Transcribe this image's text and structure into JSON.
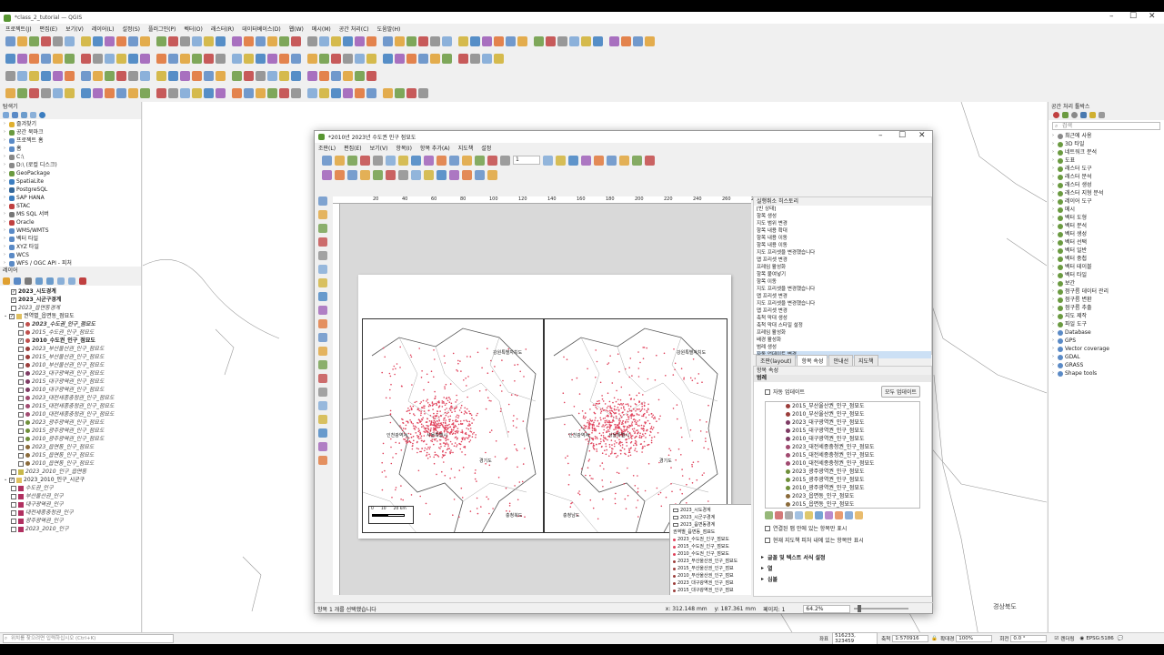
{
  "app": {
    "title": "*class_2_tutorial — QGIS",
    "menu": [
      "프로젝트(J)",
      "편집(E)",
      "보기(V)",
      "레이어(L)",
      "설정(S)",
      "플러그인(P)",
      "벡터(O)",
      "래스터(R)",
      "데이터베이스(D)",
      "웹(W)",
      "메시(M)",
      "공간 처리(C)",
      "도움말(H)"
    ]
  },
  "browser": {
    "title": "탐색기",
    "items": [
      "즐겨찾기",
      "공간 북마크",
      "프로젝트 홈",
      "홈",
      "C:\\",
      "D:\\ (로컬 디스크)",
      "GeoPackage",
      "SpatiaLite",
      "PostgreSQL",
      "SAP HANA",
      "STAC",
      "MS SQL 서버",
      "Oracle",
      "WMS/WMTS",
      "벡터 타일",
      "XYZ 타일",
      "WCS",
      "WFS / OGC API - 피처",
      "ArcGIS REST 서버",
      "신",
      "Cloud"
    ]
  },
  "layers": {
    "title": "레이어",
    "items": [
      {
        "label": "2023_시도경계",
        "style": "bold",
        "checked": true,
        "indent": 1
      },
      {
        "label": "2023_시군구경계",
        "style": "bold",
        "checked": true,
        "indent": 1
      },
      {
        "label": "2023_읍면동경계",
        "style": "italic",
        "checked": false,
        "indent": 1
      },
      {
        "label": "권역별_읍면동_점묘도",
        "style": "normal",
        "checked": true,
        "indent": 0,
        "group": true
      },
      {
        "label": "2023_수도권_인구_점묘도",
        "style": "bolditalic",
        "checked": false,
        "indent": 2,
        "dot": "#c0504d"
      },
      {
        "label": "2015_수도권_인구_점묘도",
        "style": "italic",
        "checked": false,
        "indent": 2,
        "dot": "#c0504d"
      },
      {
        "label": "2010_수도권_인구_점묘도",
        "style": "bold",
        "checked": true,
        "indent": 2,
        "dot": "#c0504d"
      },
      {
        "label": "2023_부산울산권_인구_점묘도",
        "style": "italic",
        "checked": false,
        "indent": 2,
        "dot": "#9b3d3a"
      },
      {
        "label": "2015_부산울산권_인구_점묘도",
        "style": "italic",
        "checked": false,
        "indent": 2,
        "dot": "#9b3d3a"
      },
      {
        "label": "2010_부산울산권_인구_점묘도",
        "style": "italic",
        "checked": false,
        "indent": 2,
        "dot": "#9b3d3a"
      },
      {
        "label": "2023_대구광역권_인구_점묘도",
        "style": "italic",
        "checked": false,
        "indent": 2,
        "dot": "#7e3b64"
      },
      {
        "label": "2015_대구광역권_인구_점묘도",
        "style": "italic",
        "checked": false,
        "indent": 2,
        "dot": "#7e3b64"
      },
      {
        "label": "2010_대구광역권_인구_점묘도",
        "style": "italic",
        "checked": false,
        "indent": 2,
        "dot": "#7e3b64"
      },
      {
        "label": "2023_대전세종충청권_인구_점묘도",
        "style": "italic",
        "checked": false,
        "indent": 2,
        "dot": "#a04a70"
      },
      {
        "label": "2015_대전세종충청권_인구_점묘도",
        "style": "italic",
        "checked": false,
        "indent": 2,
        "dot": "#a04a70"
      },
      {
        "label": "2010_대전세종충청권_인구_점묘도",
        "style": "italic",
        "checked": false,
        "indent": 2,
        "dot": "#a04a70"
      },
      {
        "label": "2023_광주광역권_인구_점묘도",
        "style": "italic",
        "checked": false,
        "indent": 2,
        "dot": "#6f8f3a"
      },
      {
        "label": "2015_광주광역권_인구_점묘도",
        "style": "italic",
        "checked": false,
        "indent": 2,
        "dot": "#6f8f3a"
      },
      {
        "label": "2010_광주광역권_인구_점묘도",
        "style": "italic",
        "checked": false,
        "indent": 2,
        "dot": "#6f8f3a"
      },
      {
        "label": "2023_읍면동_인구_점묘도",
        "style": "italic",
        "checked": false,
        "indent": 2,
        "dot": "#8a6a3a"
      },
      {
        "label": "2015_읍면동_인구_점묘도",
        "style": "italic",
        "checked": false,
        "indent": 2,
        "dot": "#8a6a3a"
      },
      {
        "label": "2010_읍면동_인구_점묘도",
        "style": "italic",
        "checked": false,
        "indent": 2,
        "dot": "#8a6a3a"
      },
      {
        "label": "2023_2010_인구_읍면동",
        "style": "italic",
        "checked": false,
        "indent": 1,
        "swatch": "#c8b84a"
      },
      {
        "label": "2023_2010_인구_시군구",
        "style": "normal",
        "checked": true,
        "indent": 0,
        "group": true
      },
      {
        "label": "수도권_인구",
        "style": "italic",
        "checked": false,
        "indent": 1,
        "swatch": "#b03060"
      },
      {
        "label": "부산울산권_인구",
        "style": "italic",
        "checked": false,
        "indent": 1,
        "swatch": "#b03060"
      },
      {
        "label": "대구광역권_인구",
        "style": "italic",
        "checked": false,
        "indent": 1,
        "swatch": "#b03060"
      },
      {
        "label": "대전세종충청권_인구",
        "style": "italic",
        "checked": false,
        "indent": 1,
        "swatch": "#b03060"
      },
      {
        "label": "광주광역권_인구",
        "style": "italic",
        "checked": false,
        "indent": 1,
        "swatch": "#b03060"
      },
      {
        "label": "2023_2010_인구",
        "style": "italic",
        "checked": false,
        "indent": 1,
        "swatch": "#b03060"
      }
    ]
  },
  "toolbox": {
    "title": "공간 처리 툴박스",
    "search_placeholder": "검색",
    "items": [
      "최근에 사용",
      "3D 타일",
      "네트워크 분석",
      "도표",
      "래스터 도구",
      "래스터 분석",
      "래스터 생성",
      "래스터 지형 분석",
      "레이어 도구",
      "메시",
      "벡터 도형",
      "벡터 분석",
      "벡터 생성",
      "벡터 선택",
      "벡터 일반",
      "벡터 중첩",
      "벡터 테이블",
      "벡터 타일",
      "보간",
      "점구름 데이터 관리",
      "점구름 변환",
      "점구름 추출",
      "지도 제작",
      "파일 도구",
      "Database",
      "GPS",
      "Vector coverage",
      "GDAL",
      "GRASS",
      "Shape tools"
    ]
  },
  "map_canvas": {
    "label": "경상북도"
  },
  "status": {
    "search_placeholder": "위치를 찾으려면 입력하십시오 (Ctrl+K)",
    "coord_label": "좌표",
    "coord_value": "516233, 323459",
    "scale_label": "축척",
    "scale_value": "1:570916",
    "magnifier_label": "확대경",
    "magnifier_value": "100%",
    "rotation_label": "회전",
    "rotation_value": "0.0 °",
    "render_label": "렌더링",
    "crs": "EPSG:5186"
  },
  "layout": {
    "title": "*2010년 2023년 수도권 인구 점묘도",
    "menu": [
      "조판(L)",
      "편집(E)",
      "보기(V)",
      "항목(I)",
      "항목 추가(A)",
      "지도책",
      "설정"
    ],
    "page_field": "1",
    "ruler": [
      "20",
      "40",
      "60",
      "80",
      "100",
      "120",
      "140",
      "160",
      "180",
      "200",
      "220",
      "240",
      "260",
      "280"
    ],
    "map_labels_left": [
      "강원특별자치도",
      "인천광역시",
      "서울특별시",
      "경기도",
      "충청북도"
    ],
    "map_labels_right": [
      "강원특별자치도",
      "인천광역시",
      "서울특별시",
      "경기도",
      "충청남도"
    ],
    "scalebar": [
      "0",
      "10",
      "20 km"
    ],
    "legend_items": [
      "2023_시도경계",
      "2023_시군구경계",
      "2023_읍면동경계",
      "권역별_읍면동_점묘도",
      "2023_수도권_인구_점묘도",
      "2015_수도권_인구_점묘도",
      "2010_수도권_인구_점묘도",
      "2023_부산울산권_인구_점묘도",
      "2015_부산울산권_인구_점묘",
      "2010_부산울산권_인구_점묘",
      "2023_대구광역권_인구_점묘",
      "2015_대구광역권_인구_점묘"
    ],
    "history_title": "실행취소 히스토리",
    "history": [
      "[빈 상태]",
      "항목 생성",
      "지도 범위 변경",
      "항목 내용 확대",
      "항목 내용 이동",
      "항목 내용 이동",
      "지도 프리셋을 변경했습니다",
      "맵 프리셋 변경",
      "프레임 활성화",
      "항목 붙여넣기",
      "항목 이동",
      "지도 프리셋을 변경했습니다",
      "맵 프리셋 변경",
      "지도 프리셋을 변경했습니다",
      "맵 프리셋 변경",
      "축척 막대 생성",
      "축척 막대 스타일 설정",
      "프레임 활성화",
      "배경 활성화",
      "범례 생성",
      "자동 업데이트 변경"
    ],
    "tabs": [
      "조판(layout)",
      "항목 속성",
      "안내선",
      "지도책"
    ],
    "props_title": "항목 속성",
    "props_section": "범례",
    "auto_update_label": "자동 업데이트",
    "update_all_btn": "모두 업데이트",
    "legend_tree": [
      {
        "label": "2015_부산울산권_인구_점묘도",
        "dot": "#9b3d3a"
      },
      {
        "label": "2010_부산울산권_인구_점묘도",
        "dot": "#9b3d3a"
      },
      {
        "label": "2023_대구광역권_인구_점묘도",
        "dot": "#7e3b64"
      },
      {
        "label": "2015_대구광역권_인구_점묘도",
        "dot": "#7e3b64"
      },
      {
        "label": "2010_대구광역권_인구_점묘도",
        "dot": "#7e3b64"
      },
      {
        "label": "2023_대전세종충청권_인구_점묘도",
        "dot": "#a04a70"
      },
      {
        "label": "2015_대전세종충청권_인구_점묘도",
        "dot": "#a04a70"
      },
      {
        "label": "2010_대전세종충청권_인구_점묘도",
        "dot": "#a04a70"
      },
      {
        "label": "2023_광주광역권_인구_점묘도",
        "dot": "#6f8f3a"
      },
      {
        "label": "2015_광주광역권_인구_점묘도",
        "dot": "#6f8f3a"
      },
      {
        "label": "2010_광주광역권_인구_점묘도",
        "dot": "#6f8f3a"
      },
      {
        "label": "2023_읍면동_인구_점묘도",
        "dot": "#8a6a3a"
      },
      {
        "label": "2015_읍면동_인구_점묘도",
        "dot": "#8a6a3a"
      }
    ],
    "linked_map_check": "연결된 맵 안에 있는 항목만 표시",
    "atlas_check": "현재 지도책 피처 내에 있는 항목만 표시",
    "sections": [
      "글꼴 및 텍스트 서식 설정",
      "열",
      "심볼"
    ],
    "status_msg": "항목 1 개를 선택했습니다",
    "cursor_x": "x: 312.148 mm",
    "cursor_y": "y: 187.361 mm",
    "page_label": "페이지: 1",
    "zoom_value": "64.2%"
  },
  "colors": {
    "accent": "#2b6cb0",
    "dot_red": "#e0405a"
  }
}
